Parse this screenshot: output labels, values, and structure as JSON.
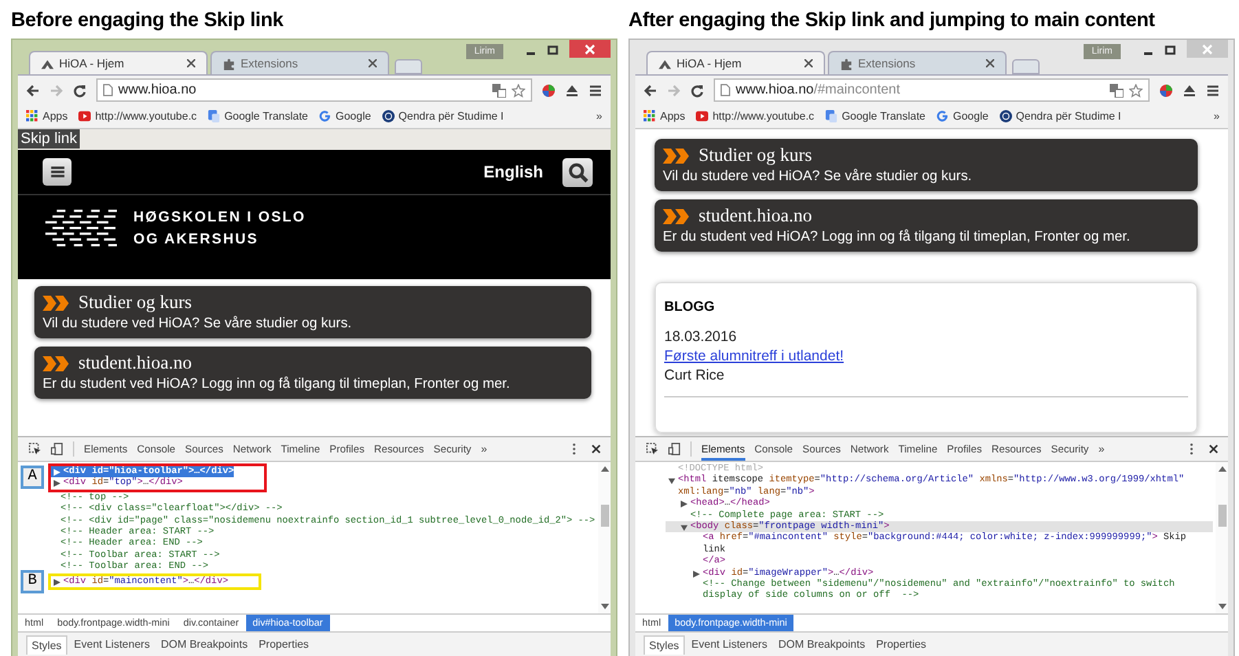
{
  "panels": [
    {
      "caption": "Before engaging the Skip link",
      "window": {
        "active": true,
        "user": "Lirim"
      },
      "tabs": [
        {
          "title": "HiOA - Hjem",
          "kind": "site",
          "selected": true
        },
        {
          "title": "Extensions",
          "kind": "extensions",
          "selected": false
        }
      ],
      "url": {
        "host": "www.hioa.no"
      },
      "bookmarks": [
        {
          "label": "Apps",
          "kind": "apps"
        },
        {
          "label": "http://www.youtube.c",
          "kind": "youtube"
        },
        {
          "label": "Google Translate",
          "kind": "translate"
        },
        {
          "label": "Google",
          "kind": "google"
        },
        {
          "label": "Qendra për Studime I",
          "kind": "qendra"
        }
      ],
      "bookmarks_more": "»",
      "page": {
        "skip_link": "Skip link",
        "header": {
          "language": "English",
          "logo_lines": [
            "HØGSKOLEN I OSLO",
            "OG AKERSHUS"
          ]
        },
        "cards": [
          {
            "title": "Studier og kurs",
            "text": "Vil du studere ved HiOA? Se våre studier og kurs."
          },
          {
            "title": "student.hioa.no",
            "text": "Er du student ved HiOA? Logg inn og få tilgang til timeplan, Fronter og mer."
          }
        ]
      },
      "devtools": {
        "focused": true,
        "tabs": [
          {
            "label": "Elements",
            "selected": false
          },
          {
            "label": "Console",
            "selected": false
          },
          {
            "label": "Sources",
            "selected": false
          },
          {
            "label": "Network",
            "selected": false
          },
          {
            "label": "Timeline",
            "selected": false
          },
          {
            "label": "Profiles",
            "selected": false
          },
          {
            "label": "Resources",
            "selected": false
          },
          {
            "label": "Security",
            "selected": false
          }
        ],
        "more": "»",
        "dom": [
          {
            "kind": "callout",
            "label": "A",
            "color": "#e8141c",
            "lines": [
              {
                "kind": "element",
                "text": "<div id=\"hioa-toolbar\">…</div>",
                "expanded": false,
                "selected": true
              },
              {
                "kind": "element",
                "text": "<div id=\"top\">…</div>",
                "expanded": false,
                "selected": false
              }
            ]
          },
          {
            "kind": "comment",
            "text": "<!-- top -->",
            "selected": false
          },
          {
            "kind": "comment",
            "text": "<!-- <div class=\"clearfloat\"></div> -->",
            "selected": false
          },
          {
            "kind": "comment",
            "text": "<!-- <div id=\"page\" class=\"nosidemenu noextrainfo section_id_1 subtree_level_0_node_id_2\"> -->",
            "selected": false
          },
          {
            "kind": "comment",
            "text": "<!-- Header area: START -->",
            "selected": false
          },
          {
            "kind": "comment",
            "text": "<!-- Header area: END -->",
            "selected": false
          },
          {
            "kind": "comment",
            "text": "<!-- Toolbar area: START -->",
            "selected": false
          },
          {
            "kind": "comment",
            "text": "<!-- Toolbar area: END -->",
            "selected": false
          },
          {
            "kind": "callout",
            "label": "B",
            "color": "#f5e400",
            "lines": [
              {
                "kind": "element",
                "text": "<div id=\"maincontent\">…</div>",
                "expanded": false,
                "selected": false
              }
            ]
          }
        ],
        "breadcrumbs": [
          {
            "label": "html",
            "selected": false
          },
          {
            "label": "body.frontpage.width-mini",
            "selected": false
          },
          {
            "label": "div.container",
            "selected": false
          },
          {
            "label": "div#hioa-toolbar",
            "selected": true
          }
        ],
        "bottom_tabs": [
          {
            "label": "Styles",
            "selected": true
          },
          {
            "label": "Event Listeners",
            "selected": false
          },
          {
            "label": "DOM Breakpoints",
            "selected": false
          },
          {
            "label": "Properties",
            "selected": false
          }
        ]
      }
    },
    {
      "caption": "After engaging the Skip link and jumping to main content",
      "window": {
        "active": false,
        "user": "Lirim"
      },
      "tabs": [
        {
          "title": "HiOA - Hjem",
          "kind": "site",
          "selected": true
        },
        {
          "title": "Extensions",
          "kind": "extensions",
          "selected": false
        }
      ],
      "url": {
        "host": "www.hioa.no",
        "rest": "/#maincontent"
      },
      "bookmarks": [
        {
          "label": "Apps",
          "kind": "apps"
        },
        {
          "label": "http://www.youtube.c",
          "kind": "youtube"
        },
        {
          "label": "Google Translate",
          "kind": "translate"
        },
        {
          "label": "Google",
          "kind": "google"
        },
        {
          "label": "Qendra për Studime I",
          "kind": "qendra"
        }
      ],
      "bookmarks_more": "»",
      "page": {
        "cards": [
          {
            "title": "Studier og kurs",
            "text": "Vil du studere ved HiOA? Se våre studier og kurs."
          },
          {
            "title": "student.hioa.no",
            "text": "Er du student ved HiOA? Logg inn og få tilgang til timeplan, Fronter og mer."
          }
        ],
        "blog": {
          "heading": "BLOGG",
          "date": "18.03.2016",
          "link": "Første alumnitreff i utlandet!",
          "author": "Curt Rice"
        }
      },
      "devtools": {
        "focused": false,
        "tabs": [
          {
            "label": "Elements",
            "selected": true
          },
          {
            "label": "Console",
            "selected": false
          },
          {
            "label": "Sources",
            "selected": false
          },
          {
            "label": "Network",
            "selected": false
          },
          {
            "label": "Timeline",
            "selected": false
          },
          {
            "label": "Profiles",
            "selected": false
          },
          {
            "label": "Resources",
            "selected": false
          },
          {
            "label": "Security",
            "selected": false
          }
        ],
        "more": "»",
        "dom": [
          {
            "kind": "doctype",
            "text": "<!DOCTYPE html>",
            "selected": false
          },
          {
            "kind": "element",
            "text": "<html itemscope itemtype=\"http://schema.org/Article\" xmlns=\"http://www.w3.org/1999/xhtml\" xml:lang=\"nb\" lang=\"nb\">",
            "expanded": true,
            "selected": false,
            "children": [
              {
                "kind": "element",
                "text": "<head>…</head>",
                "expanded": false,
                "selected": false
              },
              {
                "kind": "comment",
                "text": "<!-- Complete page area: START -->",
                "selected": false
              },
              {
                "kind": "element",
                "text": "<body class=\"frontpage width-mini\">",
                "expanded": true,
                "selected": true,
                "children": [
                  {
                    "kind": "element",
                    "text": "<a href=\"#maincontent\" style=\"background:#444; color:white; z-index:999999999;\"> Skip link",
                    "close": "</a>",
                    "selected": false
                  },
                  {
                    "kind": "element",
                    "text": "<div id=\"imageWrapper\">…</div>",
                    "expanded": false,
                    "selected": false
                  },
                  {
                    "kind": "comment",
                    "text": "<!-- Change between \"sidemenu\"/\"nosidemenu\" and \"extrainfo\"/\"noextrainfo\" to switch display of side columns on or off  -->",
                    "selected": false
                  }
                ]
              }
            ]
          }
        ],
        "breadcrumbs": [
          {
            "label": "html",
            "selected": false
          },
          {
            "label": "body.frontpage.width-mini",
            "selected": true
          }
        ],
        "bottom_tabs": [
          {
            "label": "Styles",
            "selected": true
          },
          {
            "label": "Event Listeners",
            "selected": false
          },
          {
            "label": "DOM Breakpoints",
            "selected": false
          },
          {
            "label": "Properties",
            "selected": false
          }
        ]
      }
    }
  ]
}
